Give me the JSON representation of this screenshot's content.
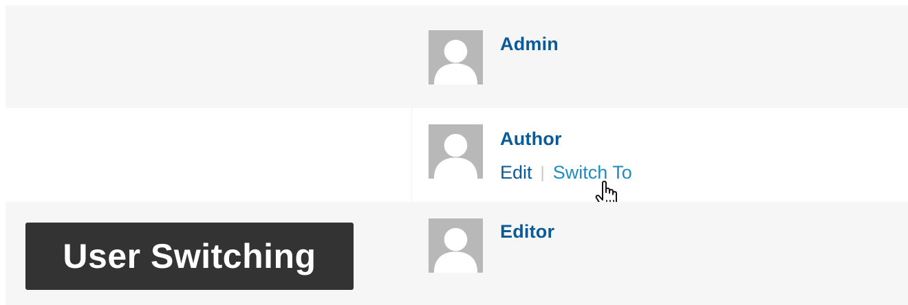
{
  "users": {
    "admin": {
      "name": "Admin"
    },
    "author": {
      "name": "Author",
      "actions": {
        "edit_label": "Edit",
        "separator": "|",
        "switch_label": "Switch To"
      }
    },
    "editor": {
      "name": "Editor"
    }
  },
  "badge": {
    "title": "User Switching"
  },
  "colors": {
    "username": "#0a5a97",
    "switch_link": "#1e8cbe",
    "row_alt": "#f6f6f6",
    "avatar_bg": "#b8b8b8",
    "badge_bg": "#333333"
  },
  "icons": {
    "avatar": "default-avatar-icon",
    "cursor": "hand-pointer-cursor-icon"
  }
}
